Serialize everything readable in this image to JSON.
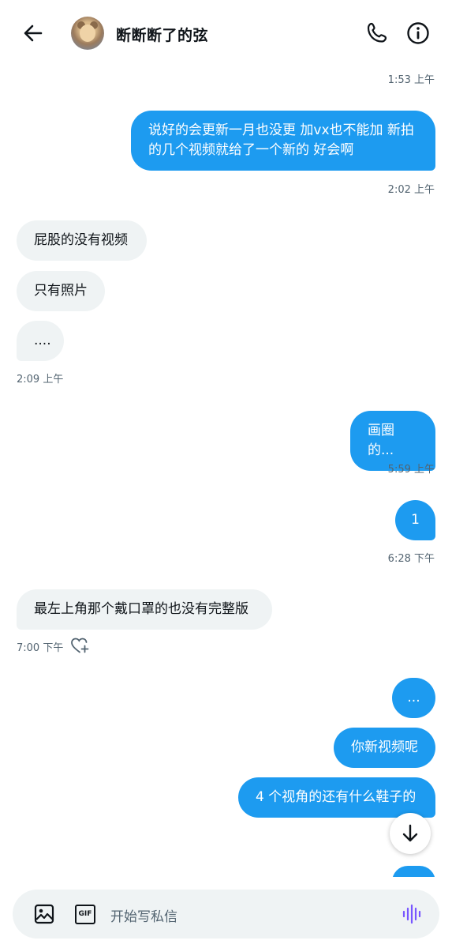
{
  "header": {
    "title": "断断断了的弦",
    "back_icon": "arrow-left-icon",
    "phone_icon": "phone-icon",
    "info_icon": "info-icon"
  },
  "messages": [
    {
      "time": "1:53 上午"
    },
    {
      "text": "说好的会更新一月也没更 加vx也不能加 新拍的几个视频就给了一个新的 好会啊",
      "time": "2:02 上午",
      "direction": "outgoing"
    },
    {
      "text": "屁股的没有视频",
      "direction": "incoming"
    },
    {
      "text": "只有照片",
      "direction": "incoming"
    },
    {
      "text": "....",
      "time": "2:09 上午",
      "direction": "incoming"
    },
    {
      "text": "画圈的...",
      "time": "5:59 上午",
      "direction": "outgoing"
    },
    {
      "text": "1",
      "time": "6:28 下午",
      "direction": "outgoing"
    },
    {
      "text": "最左上角那个戴口罩的也没有完整版",
      "time": "7:00 下午",
      "direction": "incoming"
    },
    {
      "text": "...",
      "direction": "outgoing"
    },
    {
      "text": "你新视频呢",
      "direction": "outgoing"
    },
    {
      "text": "4 个视角的还有什么鞋子的",
      "direction": "outgoing"
    }
  ],
  "composer": {
    "placeholder": "开始写私信",
    "gif_label": "GIF"
  },
  "colors": {
    "accent": "#1d9bf0",
    "incoming_bg": "#eff3f4",
    "muted": "#536471"
  }
}
